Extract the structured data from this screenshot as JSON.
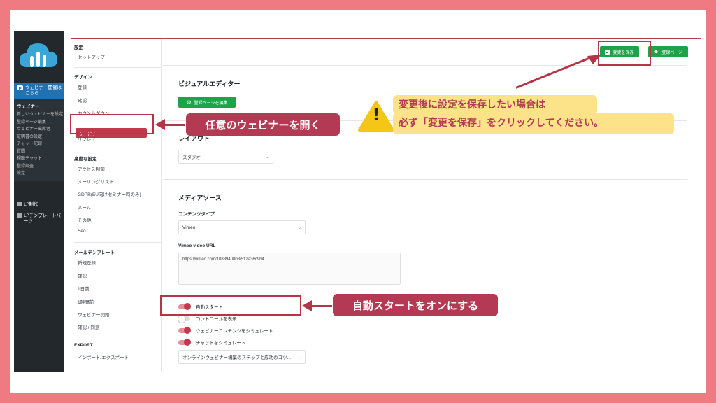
{
  "sidebar": {
    "promo_label": "ウェビナー開催はこちら",
    "section_head": "ウェビナー",
    "items": [
      "新しいウェビナーを設定",
      "登録ページ編集",
      "ウェビナー出席者",
      "証明書の設定",
      "チャット記録",
      "質問",
      "視聴チャット",
      "登録調査",
      "設定"
    ],
    "lp_label": "LP制作",
    "lp_template_label": "LPテンプレートパーツ"
  },
  "settings_nav": {
    "s1": "設定",
    "setup": "セットアップ",
    "s2": "デザイン",
    "register": "登録",
    "confirm": "確認",
    "countdown": "カウントダウン",
    "webinar": "ウェビナー",
    "replay": "リプレイ",
    "s3": "高度な設定",
    "access": "アクセス制御",
    "mailing": "メーリングリスト",
    "gdpr": "GDPR(EU向けセミナー時のみ)",
    "mail": "メール",
    "other": "その他",
    "seo": "Seo",
    "s4": "メールテンプレート",
    "new_reg": "新規登録",
    "kakunin": "確認",
    "day_before": "1日前",
    "hour_before": "1時間前",
    "start": "ウェビナー開始",
    "confirm_agree": "確認 / 同意",
    "s5": "EXPORT",
    "import_export": "インポート/エクスポート"
  },
  "main": {
    "save_button": "変更を保存",
    "register_page_button": "登録ページ",
    "visual_editor_title": "ビジュアルエディター",
    "edit_register_page_button": "登録ページを編集",
    "layout_title": "レイアウト",
    "layout_value": "スタジオ",
    "media_title": "メディアソース",
    "content_type_label": "コンテンツタイプ",
    "content_type_value": "Vimeo",
    "vimeo_url_label": "Vimeo video URL",
    "vimeo_url_value": "https://vimeo.com/1088940808/512a36c9b4",
    "toggles": [
      {
        "label": "自動スタート",
        "on": true
      },
      {
        "label": "コントロールを表示",
        "on": false
      },
      {
        "label": "ウェビナーコンテンツをシミュレート",
        "on": true
      },
      {
        "label": "チャットをシミュレート",
        "on": true
      }
    ],
    "bottom_select_value": "オンラインウェビナー構築のステップと成功のコツ..."
  },
  "annotations": {
    "open_webinar": "任意のウェビナーを開く",
    "warning_line1": "変更後に設定を保存したい場合は",
    "warning_line2": "必ず「変更を保存」をクリックしてください。",
    "autostart": "自動スタートをオンにする",
    "warning_symbol": "!"
  },
  "colors": {
    "accent": "#b33a52",
    "green": "#1fa34a",
    "frame": "#f07a82",
    "warning_bg": "#fce38a"
  }
}
